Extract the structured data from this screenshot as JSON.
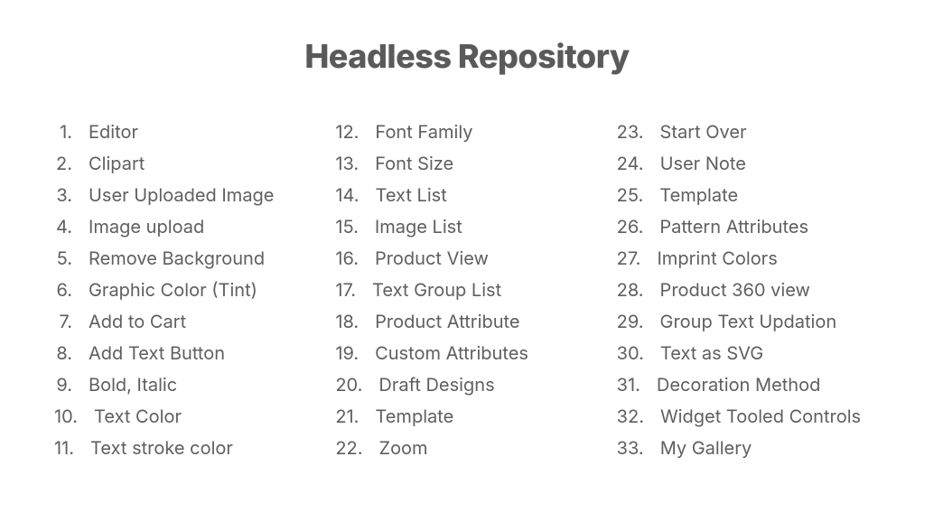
{
  "title": "Headless Repository",
  "columns": [
    {
      "items": [
        {
          "num": "1.",
          "label": "Editor"
        },
        {
          "num": "2.",
          "label": "Clipart"
        },
        {
          "num": "3.",
          "label": "User Uploaded Image"
        },
        {
          "num": "4.",
          "label": "Image upload"
        },
        {
          "num": "5.",
          "label": "Remove Background"
        },
        {
          "num": "6.",
          "label": "Graphic Color (Tint)"
        },
        {
          "num": "7.",
          "label": "Add to Cart"
        },
        {
          "num": "8.",
          "label": "Add Text Button"
        },
        {
          "num": "9.",
          "label": "Bold, Italic"
        },
        {
          "num": "10.",
          "label": "Text Color"
        },
        {
          "num": "11.",
          "label": "Text stroke color"
        }
      ]
    },
    {
      "items": [
        {
          "num": "12.",
          "label": "Font Family"
        },
        {
          "num": "13.",
          "label": "Font Size"
        },
        {
          "num": "14.",
          "label": "Text List"
        },
        {
          "num": "15.",
          "label": "Image List"
        },
        {
          "num": "16.",
          "label": "Product View"
        },
        {
          "num": "17.",
          "label": "Text Group List"
        },
        {
          "num": "18.",
          "label": "Product Attribute"
        },
        {
          "num": "19.",
          "label": "Custom Attributes"
        },
        {
          "num": "20.",
          "label": "Draft Designs"
        },
        {
          "num": "21.",
          "label": "Template"
        },
        {
          "num": "22.",
          "label": "Zoom"
        }
      ]
    },
    {
      "items": [
        {
          "num": "23.",
          "label": "Start Over"
        },
        {
          "num": "24.",
          "label": "User Note"
        },
        {
          "num": "25.",
          "label": "Template"
        },
        {
          "num": "26.",
          "label": "Pattern Attributes"
        },
        {
          "num": "27.",
          "label": "Imprint Colors"
        },
        {
          "num": "28.",
          "label": "Product 360 view"
        },
        {
          "num": "29.",
          "label": "Group Text Updation"
        },
        {
          "num": "30.",
          "label": "Text as SVG"
        },
        {
          "num": "31.",
          "label": "Decoration Method"
        },
        {
          "num": "32.",
          "label": "Widget Tooled Controls"
        },
        {
          "num": "33.",
          "label": "My Gallery"
        }
      ]
    }
  ]
}
